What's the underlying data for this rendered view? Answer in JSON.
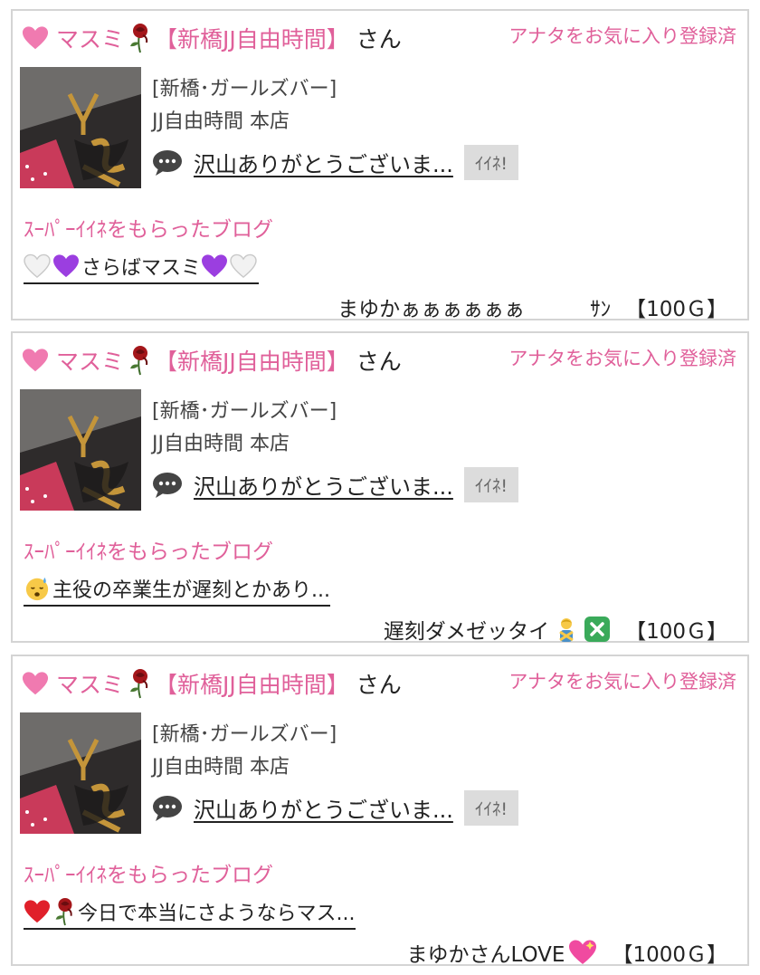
{
  "colors": {
    "accent_pink": "#e0609a",
    "border": "#d4d4d4",
    "iine_bg": "#dcdcdc"
  },
  "cards": [
    {
      "sender_name": "マスミ",
      "shop_tag": "【新橋JJ自由時間】",
      "san": "さん",
      "favorite_status": "アナタをお気に入り登録済",
      "category": "[新橋･ガールズバー]",
      "store_name": "JJ自由時間 本店",
      "comment": "沢山ありがとうございま...",
      "iine_label": "ｲｲﾈ!",
      "super_label": "ｽｰﾊﾟｰｲｲﾈをもらったブログ",
      "blog_title": "さらばマスミ",
      "message": "まゆかぁぁぁぁぁぁ",
      "message_suffix": "ｻﾝ",
      "points": "【100Ｇ】"
    },
    {
      "sender_name": "マスミ",
      "shop_tag": "【新橋JJ自由時間】",
      "san": "さん",
      "favorite_status": "アナタをお気に入り登録済",
      "category": "[新橋･ガールズバー]",
      "store_name": "JJ自由時間 本店",
      "comment": "沢山ありがとうございま...",
      "iine_label": "ｲｲﾈ!",
      "super_label": "ｽｰﾊﾟｰｲｲﾈをもらったブログ",
      "blog_title": "主役の卒業生が遅刻とかあり...",
      "message": "遅刻ダメゼッタイ",
      "points": "【100Ｇ】"
    },
    {
      "sender_name": "マスミ",
      "shop_tag": "【新橋JJ自由時間】",
      "san": "さん",
      "favorite_status": "アナタをお気に入り登録済",
      "category": "[新橋･ガールズバー]",
      "store_name": "JJ自由時間 本店",
      "comment": "沢山ありがとうございま...",
      "iine_label": "ｲｲﾈ!",
      "super_label": "ｽｰﾊﾟｰｲｲﾈをもらったブログ",
      "blog_title": "今日で本当にさようならマス...",
      "message": "まゆかさんLOVE",
      "points": "【1000Ｇ】"
    }
  ]
}
